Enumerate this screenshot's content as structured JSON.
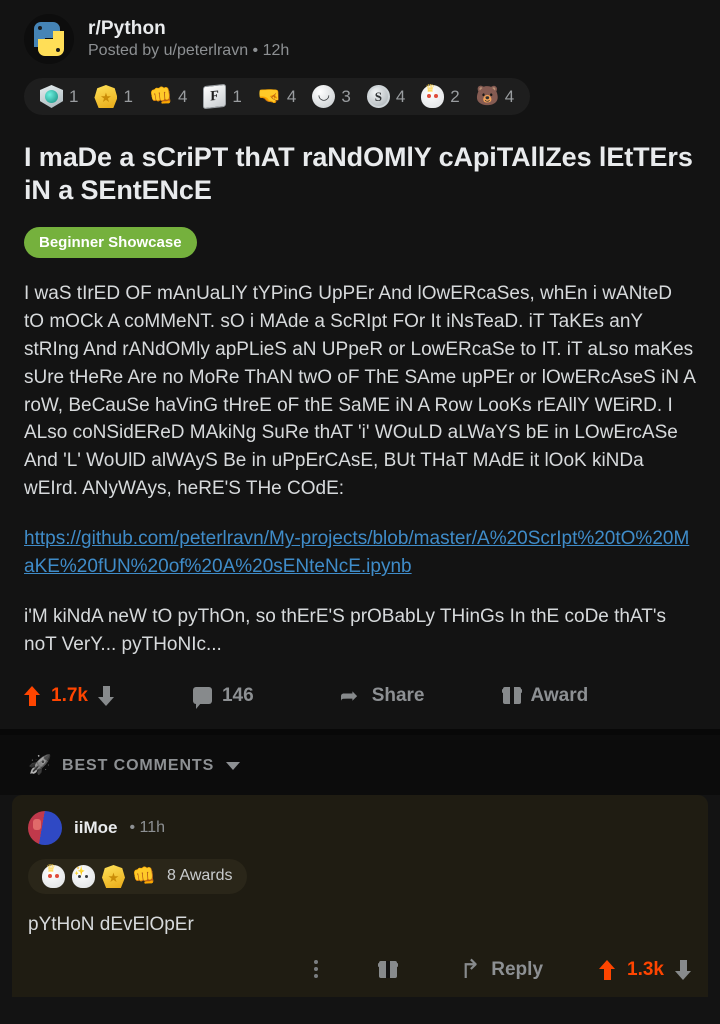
{
  "post": {
    "subreddit": "r/Python",
    "subreddit_icon": "python-logo-icon",
    "meta": "Posted by u/peterlravn • 12h",
    "awards": [
      {
        "icon": "silver-shield-award-icon",
        "count": "1"
      },
      {
        "icon": "gold-star-medal-award-icon",
        "count": "1"
      },
      {
        "icon": "take-my-energy-award-icon",
        "count": "4"
      },
      {
        "icon": "press-f-award-icon",
        "count": "1"
      },
      {
        "icon": "strong-arm-award-icon",
        "count": "4"
      },
      {
        "icon": "lol-face-award-icon",
        "count": "3"
      },
      {
        "icon": "silver-s-coin-award-icon",
        "count": "4"
      },
      {
        "icon": "crowned-skull-award-icon",
        "count": "2"
      },
      {
        "icon": "bear-hug-award-icon",
        "count": "4"
      }
    ],
    "title": "I maDe a sCriPT thAT raNdOMlY cApiTAllZes lEtTErs iN a SEntENcE",
    "flair": "Beginner Showcase",
    "body_paragraph_1": "I waS tIrED OF mAnUaLlY tYPinG UpPEr And lOwERcaSes, whEn i wANteD tO mOCk A coMMeNT. sO i MAde a ScRIpt FOr It iNsTeaD. iT TaKEs anY stRIng And rANdOMly apPLieS aN UPpeR or LowERcaSe to IT. iT aLso maKes sUre tHeRe Are no MoRe ThAN twO oF ThE SAme upPEr or lOwERcAseS iN A roW, BeCauSe haVinG tHreE oF thE SaME iN A Row LooKs rEAllY WEiRD. I ALso coNSidEReD MAkiNg SuRe thAT 'i' WOuLD aLWaYS bE in LOwErcASe And 'L' WoUlD alWAyS Be in uPpErCAsE, BUt THaT MAdE it lOoK kiNDa wEIrd. ANyWAys, heRE'S THe COdE:",
    "link": "https://github.com/peterlravn/My-projects/blob/master/A%20ScrIpt%20tO%20MaKE%20fUN%20of%20A%20sENteNcE.ipynb",
    "body_paragraph_2": "i'M kiNdA neW tO pyThOn, so thErE'S prOBabLy THinGs In thE coDe thAT's noT VerY... pyTHoNIc...",
    "actions": {
      "upvote_icon": "upvote-arrow-icon",
      "score": "1.7k",
      "downvote_icon": "downvote-arrow-icon",
      "comments_icon": "comment-bubble-icon",
      "comments_count": "146",
      "share_icon": "share-arrow-icon",
      "share_label": "Share",
      "award_icon": "gift-award-icon",
      "award_label": "Award"
    }
  },
  "comments_section": {
    "sort_icon": "rocket-icon",
    "sort_label": "BEST COMMENTS",
    "sort_chevron_icon": "chevron-down-icon",
    "comments": [
      {
        "avatar": "user-avatar-icon",
        "author": "iiMoe",
        "meta": "• 11h",
        "award_icons": [
          "crowned-skull-award-icon",
          "sparkle-skull-award-icon",
          "gold-star-medal-award-icon",
          "take-my-energy-award-icon"
        ],
        "awards_label": "8 Awards",
        "text": "pYtHoN dEvElOpEr",
        "actions": {
          "more_icon": "more-options-icon",
          "gift_icon": "gift-award-icon",
          "reply_icon": "reply-arrow-icon",
          "reply_label": "Reply",
          "upvote_icon": "upvote-arrow-icon",
          "score": "1.3k",
          "downvote_icon": "downvote-arrow-icon"
        }
      }
    ]
  },
  "colors": {
    "background": "#131313",
    "upvote_orange": "#ff4500",
    "flair_green": "#75b13d",
    "link_blue": "#3f8cc9",
    "gilded_card": "#1f1c12"
  }
}
